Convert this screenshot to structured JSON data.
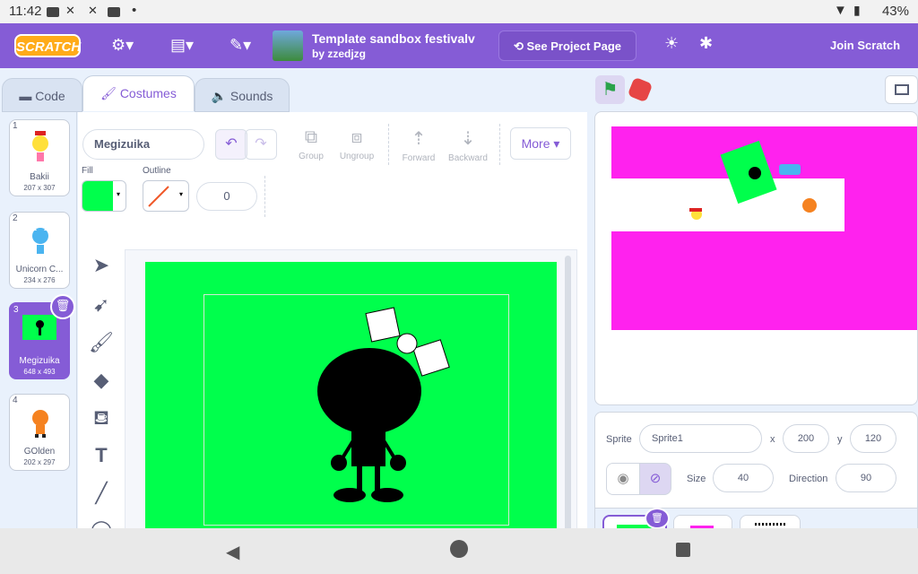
{
  "status": {
    "time": "11:42",
    "battery": "43%"
  },
  "menu": {
    "logo": "SCRATCH",
    "project_title": "Template sandbox festivalv",
    "project_author": "by zzedjzg",
    "see_project": "See Project Page",
    "join": "Join Scratch"
  },
  "tabs": {
    "code": "Code",
    "costumes": "Costumes",
    "sounds": "Sounds"
  },
  "costumes": [
    {
      "num": "1",
      "name": "Bakii",
      "size": "207 x 307"
    },
    {
      "num": "2",
      "name": "Unicorn C...",
      "size": "234 x 276"
    },
    {
      "num": "3",
      "name": "Megizuika",
      "size": "648 x 493"
    },
    {
      "num": "4",
      "name": "GOlden",
      "size": "202 x 297"
    }
  ],
  "editor": {
    "costume_name": "Megizuika",
    "group": "Group",
    "ungroup": "Ungroup",
    "forward": "Forward",
    "backward": "Backward",
    "more": "More",
    "fill_label": "Fill",
    "outline_label": "Outline",
    "outline_width": "0",
    "fill_color": "#00ff4c"
  },
  "sprite": {
    "label": "Sprite",
    "name": "Sprite1",
    "x_label": "x",
    "x": "200",
    "y_label": "y",
    "y": "120",
    "size_label": "Size",
    "size": "40",
    "direction_label": "Direction",
    "direction": "90"
  },
  "colors": {
    "accent": "#855cd6",
    "stage_pink": "#ff22ee",
    "canvas_green": "#00ff4c"
  }
}
